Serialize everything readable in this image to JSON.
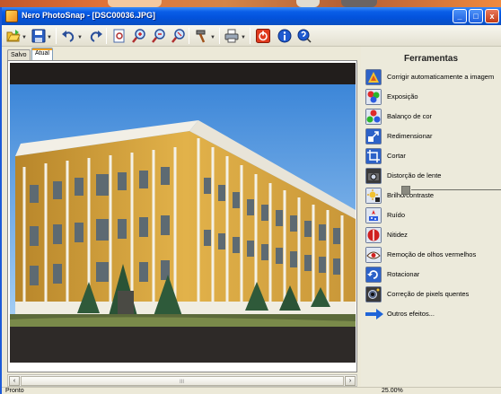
{
  "window": {
    "title": "Nero PhotoSnap - [DSC00036.JPG]",
    "minimize": "_",
    "maximize": "□",
    "close": "x"
  },
  "toolbar": {
    "buttons": [
      "open-folder-icon",
      "save-icon",
      "undo-icon",
      "redo-icon",
      "fit-page-icon",
      "zoom-in-icon",
      "zoom-out-icon",
      "zoom-actual-icon",
      "tools-hammer-icon",
      "print-icon",
      "power-icon",
      "info-icon",
      "help-icon"
    ]
  },
  "tabs": [
    {
      "label": "Salvo",
      "active": false
    },
    {
      "label": "Atual",
      "active": true
    }
  ],
  "panel": {
    "title": "Ferramentas",
    "tools": [
      {
        "label": "Corrigir automaticamente a imagem",
        "icon": "auto-fix-icon"
      },
      {
        "label": "Exposição",
        "icon": "exposure-icon"
      },
      {
        "label": "Balanço de cor",
        "icon": "color-balance-icon"
      },
      {
        "label": "Redimensionar",
        "icon": "resize-icon"
      },
      {
        "label": "Cortar",
        "icon": "crop-icon"
      },
      {
        "label": "Distorção de lente",
        "icon": "lens-distortion-icon"
      },
      {
        "label": "Brilho/contraste",
        "icon": "brightness-contrast-icon"
      },
      {
        "label": "Ruído",
        "icon": "noise-icon"
      },
      {
        "label": "Nitidez",
        "icon": "sharpness-icon"
      },
      {
        "label": "Remoção de olhos vermelhos",
        "icon": "red-eye-icon"
      },
      {
        "label": "Rotacionar",
        "icon": "rotate-icon"
      },
      {
        "label": "Correção de pixels quentes",
        "icon": "hot-pixels-icon"
      },
      {
        "label": "Outros efeitos...",
        "icon": "arrow-right-icon"
      }
    ]
  },
  "scrollbar": {
    "grip": "III",
    "left": "‹",
    "right": "›"
  },
  "status": {
    "text": "Pronto",
    "zoom": "25.00%"
  },
  "colors": {
    "title_bar": "#0352db",
    "tab_accent": "#f3a01c",
    "arrow": "#1e64d8"
  }
}
